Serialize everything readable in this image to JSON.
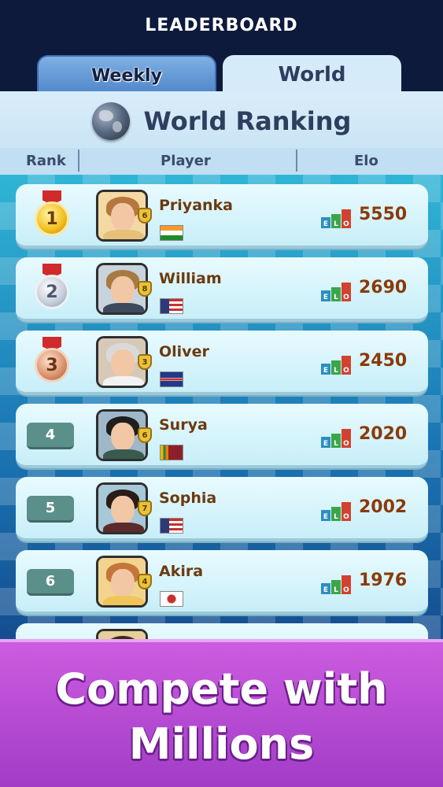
{
  "header": {
    "title": "LEADERBOARD"
  },
  "tabs": [
    {
      "label": "Weekly",
      "active": false
    },
    {
      "label": "World",
      "active": true
    }
  ],
  "ranking": {
    "title": "World Ranking",
    "columns": [
      "Rank",
      "Player",
      "Elo"
    ]
  },
  "players": [
    {
      "rank": "1",
      "name": "Priyanka",
      "level": "6",
      "flag": "india",
      "elo": "5550",
      "medal": "gold"
    },
    {
      "rank": "2",
      "name": "William",
      "level": "8",
      "flag": "usa",
      "elo": "2690",
      "medal": "silver"
    },
    {
      "rank": "3",
      "name": "Oliver",
      "level": "3",
      "flag": "uk",
      "elo": "2450",
      "medal": "bronze"
    },
    {
      "rank": "4",
      "name": "Surya",
      "level": "6",
      "flag": "sri-lanka",
      "elo": "2020",
      "medal": ""
    },
    {
      "rank": "5",
      "name": "Sophia",
      "level": "7",
      "flag": "usa",
      "elo": "2002",
      "medal": ""
    },
    {
      "rank": "6",
      "name": "Akira",
      "level": "4",
      "flag": "japan",
      "elo": "1976",
      "medal": ""
    }
  ],
  "elo_badge": {
    "letters": [
      "E",
      "L",
      "O"
    ]
  },
  "banner": {
    "line1": "Compete with",
    "line2": "Millions"
  },
  "colors": {
    "accent": "#a23cc6",
    "row_bg": "#d8f5fc",
    "name": "#6b3a10",
    "elo": "#8a3a0a"
  }
}
